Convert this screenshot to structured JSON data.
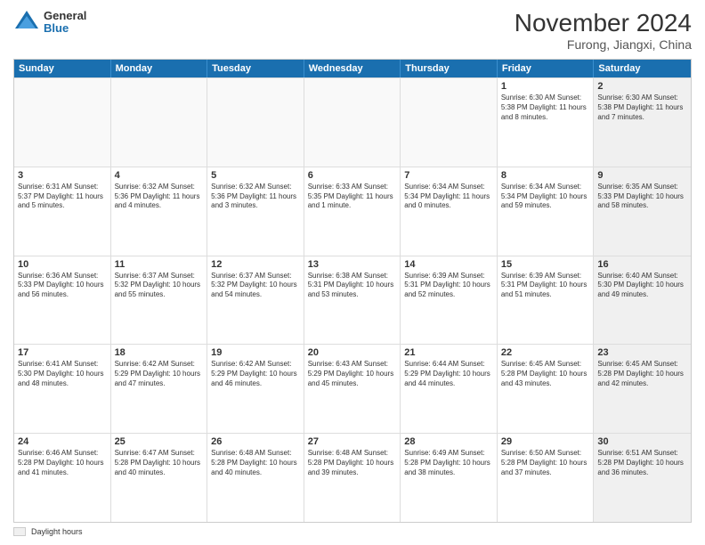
{
  "logo": {
    "line1": "General",
    "line2": "Blue"
  },
  "title": "November 2024",
  "subtitle": "Furong, Jiangxi, China",
  "days_of_week": [
    "Sunday",
    "Monday",
    "Tuesday",
    "Wednesday",
    "Thursday",
    "Friday",
    "Saturday"
  ],
  "legend_label": "Daylight hours",
  "weeks": [
    [
      {
        "day": "",
        "info": "",
        "shaded": false,
        "empty": true
      },
      {
        "day": "",
        "info": "",
        "shaded": false,
        "empty": true
      },
      {
        "day": "",
        "info": "",
        "shaded": false,
        "empty": true
      },
      {
        "day": "",
        "info": "",
        "shaded": false,
        "empty": true
      },
      {
        "day": "",
        "info": "",
        "shaded": false,
        "empty": true
      },
      {
        "day": "1",
        "info": "Sunrise: 6:30 AM\nSunset: 5:38 PM\nDaylight: 11 hours and 8 minutes.",
        "shaded": false,
        "empty": false
      },
      {
        "day": "2",
        "info": "Sunrise: 6:30 AM\nSunset: 5:38 PM\nDaylight: 11 hours and 7 minutes.",
        "shaded": true,
        "empty": false
      }
    ],
    [
      {
        "day": "3",
        "info": "Sunrise: 6:31 AM\nSunset: 5:37 PM\nDaylight: 11 hours and 5 minutes.",
        "shaded": false,
        "empty": false
      },
      {
        "day": "4",
        "info": "Sunrise: 6:32 AM\nSunset: 5:36 PM\nDaylight: 11 hours and 4 minutes.",
        "shaded": false,
        "empty": false
      },
      {
        "day": "5",
        "info": "Sunrise: 6:32 AM\nSunset: 5:36 PM\nDaylight: 11 hours and 3 minutes.",
        "shaded": false,
        "empty": false
      },
      {
        "day": "6",
        "info": "Sunrise: 6:33 AM\nSunset: 5:35 PM\nDaylight: 11 hours and 1 minute.",
        "shaded": false,
        "empty": false
      },
      {
        "day": "7",
        "info": "Sunrise: 6:34 AM\nSunset: 5:34 PM\nDaylight: 11 hours and 0 minutes.",
        "shaded": false,
        "empty": false
      },
      {
        "day": "8",
        "info": "Sunrise: 6:34 AM\nSunset: 5:34 PM\nDaylight: 10 hours and 59 minutes.",
        "shaded": false,
        "empty": false
      },
      {
        "day": "9",
        "info": "Sunrise: 6:35 AM\nSunset: 5:33 PM\nDaylight: 10 hours and 58 minutes.",
        "shaded": true,
        "empty": false
      }
    ],
    [
      {
        "day": "10",
        "info": "Sunrise: 6:36 AM\nSunset: 5:33 PM\nDaylight: 10 hours and 56 minutes.",
        "shaded": false,
        "empty": false
      },
      {
        "day": "11",
        "info": "Sunrise: 6:37 AM\nSunset: 5:32 PM\nDaylight: 10 hours and 55 minutes.",
        "shaded": false,
        "empty": false
      },
      {
        "day": "12",
        "info": "Sunrise: 6:37 AM\nSunset: 5:32 PM\nDaylight: 10 hours and 54 minutes.",
        "shaded": false,
        "empty": false
      },
      {
        "day": "13",
        "info": "Sunrise: 6:38 AM\nSunset: 5:31 PM\nDaylight: 10 hours and 53 minutes.",
        "shaded": false,
        "empty": false
      },
      {
        "day": "14",
        "info": "Sunrise: 6:39 AM\nSunset: 5:31 PM\nDaylight: 10 hours and 52 minutes.",
        "shaded": false,
        "empty": false
      },
      {
        "day": "15",
        "info": "Sunrise: 6:39 AM\nSunset: 5:31 PM\nDaylight: 10 hours and 51 minutes.",
        "shaded": false,
        "empty": false
      },
      {
        "day": "16",
        "info": "Sunrise: 6:40 AM\nSunset: 5:30 PM\nDaylight: 10 hours and 49 minutes.",
        "shaded": true,
        "empty": false
      }
    ],
    [
      {
        "day": "17",
        "info": "Sunrise: 6:41 AM\nSunset: 5:30 PM\nDaylight: 10 hours and 48 minutes.",
        "shaded": false,
        "empty": false
      },
      {
        "day": "18",
        "info": "Sunrise: 6:42 AM\nSunset: 5:29 PM\nDaylight: 10 hours and 47 minutes.",
        "shaded": false,
        "empty": false
      },
      {
        "day": "19",
        "info": "Sunrise: 6:42 AM\nSunset: 5:29 PM\nDaylight: 10 hours and 46 minutes.",
        "shaded": false,
        "empty": false
      },
      {
        "day": "20",
        "info": "Sunrise: 6:43 AM\nSunset: 5:29 PM\nDaylight: 10 hours and 45 minutes.",
        "shaded": false,
        "empty": false
      },
      {
        "day": "21",
        "info": "Sunrise: 6:44 AM\nSunset: 5:29 PM\nDaylight: 10 hours and 44 minutes.",
        "shaded": false,
        "empty": false
      },
      {
        "day": "22",
        "info": "Sunrise: 6:45 AM\nSunset: 5:28 PM\nDaylight: 10 hours and 43 minutes.",
        "shaded": false,
        "empty": false
      },
      {
        "day": "23",
        "info": "Sunrise: 6:45 AM\nSunset: 5:28 PM\nDaylight: 10 hours and 42 minutes.",
        "shaded": true,
        "empty": false
      }
    ],
    [
      {
        "day": "24",
        "info": "Sunrise: 6:46 AM\nSunset: 5:28 PM\nDaylight: 10 hours and 41 minutes.",
        "shaded": false,
        "empty": false
      },
      {
        "day": "25",
        "info": "Sunrise: 6:47 AM\nSunset: 5:28 PM\nDaylight: 10 hours and 40 minutes.",
        "shaded": false,
        "empty": false
      },
      {
        "day": "26",
        "info": "Sunrise: 6:48 AM\nSunset: 5:28 PM\nDaylight: 10 hours and 40 minutes.",
        "shaded": false,
        "empty": false
      },
      {
        "day": "27",
        "info": "Sunrise: 6:48 AM\nSunset: 5:28 PM\nDaylight: 10 hours and 39 minutes.",
        "shaded": false,
        "empty": false
      },
      {
        "day": "28",
        "info": "Sunrise: 6:49 AM\nSunset: 5:28 PM\nDaylight: 10 hours and 38 minutes.",
        "shaded": false,
        "empty": false
      },
      {
        "day": "29",
        "info": "Sunrise: 6:50 AM\nSunset: 5:28 PM\nDaylight: 10 hours and 37 minutes.",
        "shaded": false,
        "empty": false
      },
      {
        "day": "30",
        "info": "Sunrise: 6:51 AM\nSunset: 5:28 PM\nDaylight: 10 hours and 36 minutes.",
        "shaded": true,
        "empty": false
      }
    ]
  ]
}
